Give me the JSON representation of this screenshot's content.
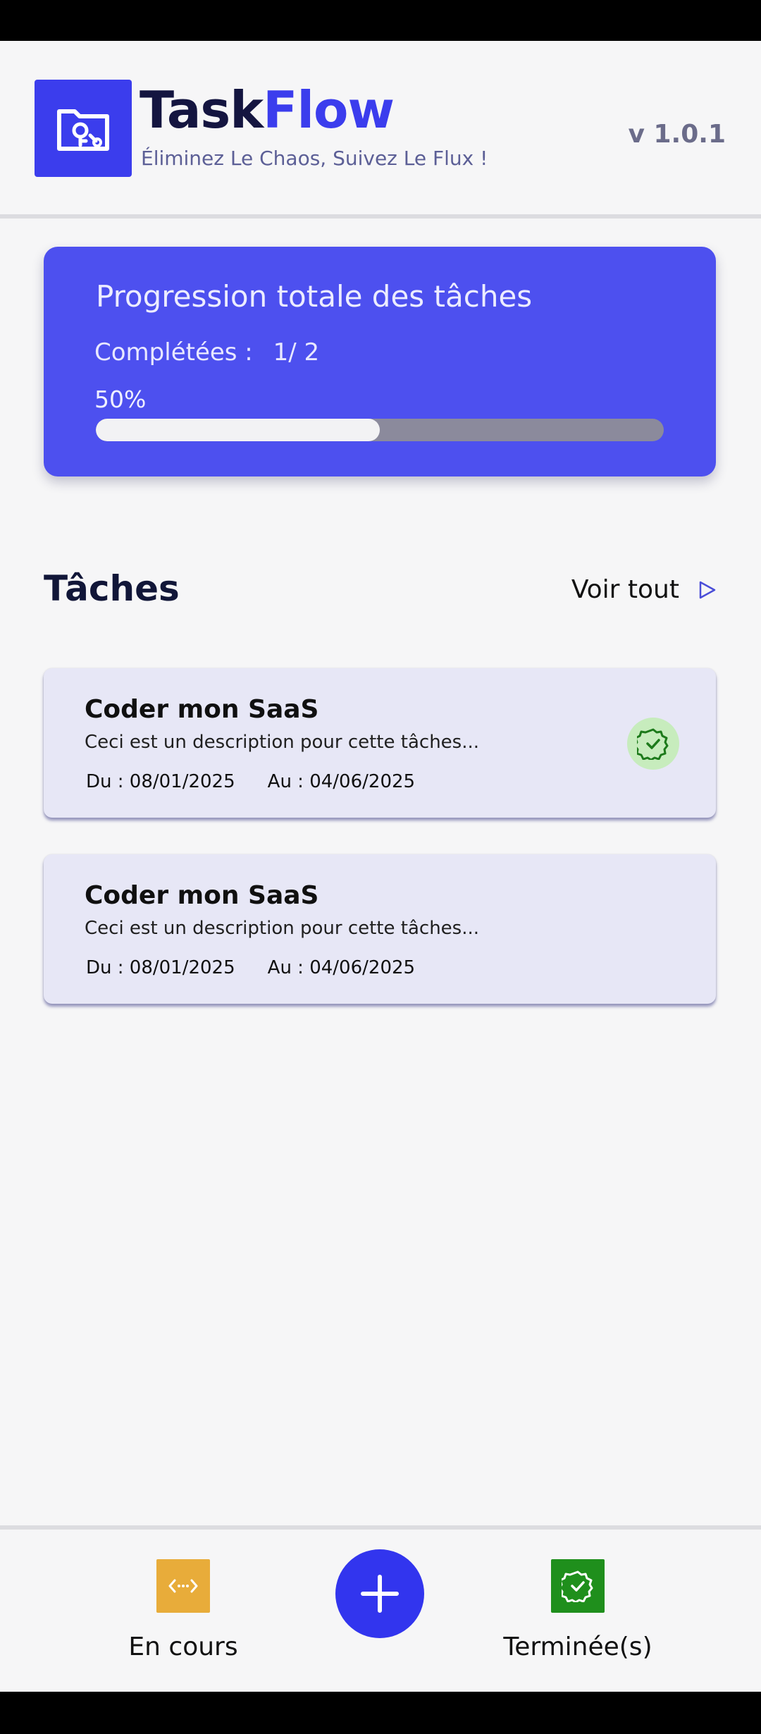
{
  "app": {
    "name_part1": "Task",
    "name_part2": "Flow",
    "tagline": "Éliminez Le Chaos, Suivez Le Flux !",
    "version": "v 1.0.1",
    "accent_color": "#3b3ded"
  },
  "progress": {
    "title": "Progression totale des tâches",
    "completed_label": "Complétées :",
    "completed_value": "1/ 2",
    "percent_label": "50%",
    "fraction": 0.5
  },
  "tasks_section": {
    "title": "Tâches",
    "see_all": "Voir tout"
  },
  "tasks": [
    {
      "title": "Coder mon SaaS",
      "description": "Ceci est un description pour cette tâches...",
      "start": "Du : 08/01/2025",
      "end": "Au :  04/06/2025",
      "completed": true
    },
    {
      "title": "Coder mon SaaS",
      "description": "Ceci est un description pour cette tâches...",
      "start": "Du : 08/01/2025",
      "end": "Au :  04/06/2025",
      "completed": false
    }
  ],
  "bottom_nav": {
    "in_progress_label": "En cours",
    "in_progress_color": "#e8ac3a",
    "done_label": "Terminée(s)",
    "done_color": "#1f8f1c",
    "add_icon": "plus-icon"
  }
}
